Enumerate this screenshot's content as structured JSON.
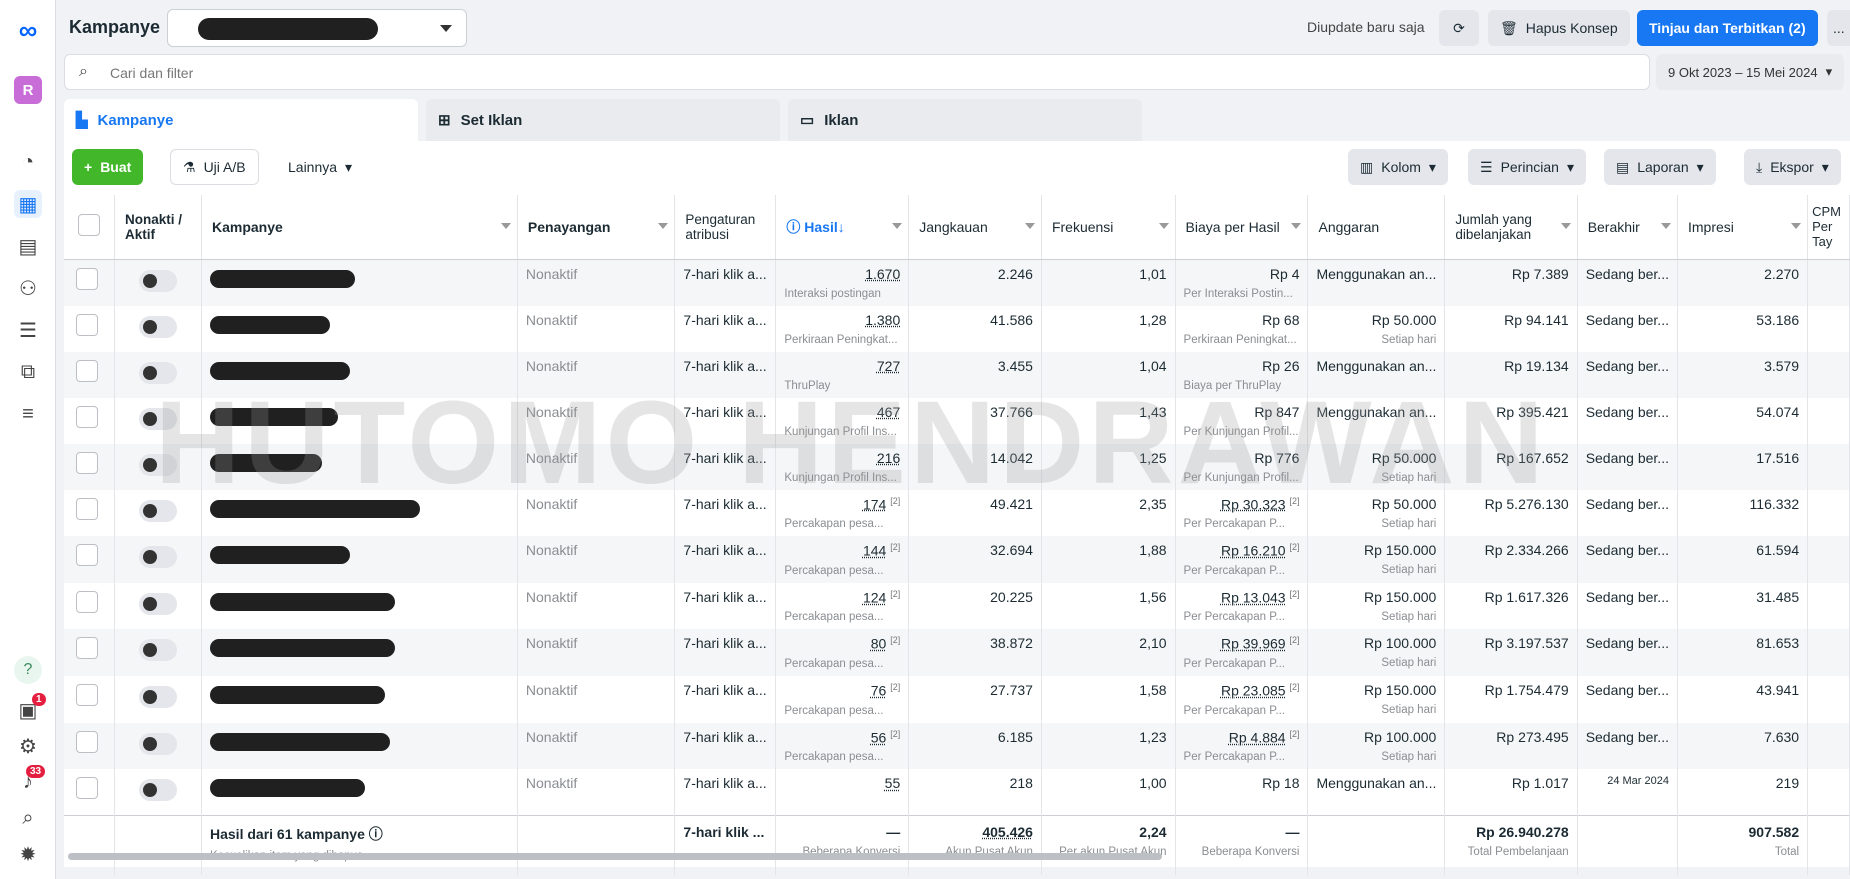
{
  "header": {
    "title": "Kampanye",
    "updated": "Diupdate baru saja",
    "discard": "Hapus Konsep",
    "publish": "Tinjau dan Terbitkan (2)",
    "more": "..."
  },
  "search": {
    "placeholder": "Cari dan filter",
    "date_range": "9 Okt 2023 – 15 Mei 2024"
  },
  "tabs": [
    "Kampanye",
    "Set Iklan",
    "Iklan"
  ],
  "toolbar": {
    "create": "Buat",
    "ab": "Uji A/B",
    "more": "Lainnya",
    "columns": "Kolom",
    "breakdown": "Perincian",
    "reports": "Laporan",
    "export": "Ekspor"
  },
  "rail": {
    "avatar": "R",
    "badge1": "1",
    "badge2": "33",
    "help": "?"
  },
  "columns": [
    "Nonakti / Aktif",
    "Kampanye",
    "Penayangan",
    "Pengaturan atribusi",
    "Hasil",
    "Jangkauan",
    "Frekuensi",
    "Biaya per Hasil",
    "Anggaran",
    "Jumlah yang dibelanjakan",
    "Berakhir",
    "Impresi",
    "CPM Per Tay"
  ],
  "rows": [
    {
      "del": "Nonaktif",
      "attr": "7-hari klik a...",
      "res": "1.670",
      "resSub": "Interaksi postingan",
      "reach": "2.246",
      "freq": "1,01",
      "cpr": "Rp 4",
      "cprSub": "Per Interaksi Postin...",
      "budget": "Menggunakan an...",
      "budgetSub": "",
      "spent": "Rp 7.389",
      "end": "Sedang ber...",
      "imp": "2.270"
    },
    {
      "del": "Nonaktif",
      "attr": "7-hari klik a...",
      "res": "1.380",
      "resSub": "Perkiraan Peningkat...",
      "reach": "41.586",
      "freq": "1,28",
      "cpr": "Rp 68",
      "cprSub": "Perkiraan Peningkat...",
      "budget": "Rp 50.000",
      "budgetSub": "Setiap hari",
      "spent": "Rp 94.141",
      "end": "Sedang ber...",
      "imp": "53.186"
    },
    {
      "del": "Nonaktif",
      "attr": "7-hari klik a...",
      "res": "727",
      "resSub": "ThruPlay",
      "reach": "3.455",
      "freq": "1,04",
      "cpr": "Rp 26",
      "cprSub": "Biaya per ThruPlay",
      "budget": "Menggunakan an...",
      "budgetSub": "",
      "spent": "Rp 19.134",
      "end": "Sedang ber...",
      "imp": "3.579"
    },
    {
      "del": "Nonaktif",
      "attr": "7-hari klik a...",
      "res": "467",
      "resSub": "Kunjungan Profil Ins...",
      "reach": "37.766",
      "freq": "1,43",
      "cpr": "Rp 847",
      "cprSub": "Per Kunjungan Profil...",
      "budget": "Menggunakan an...",
      "budgetSub": "",
      "spent": "Rp 395.421",
      "end": "Sedang ber...",
      "imp": "54.074"
    },
    {
      "del": "Nonaktif",
      "attr": "7-hari klik a...",
      "res": "216",
      "resSub": "Kunjungan Profil Ins...",
      "reach": "14.042",
      "freq": "1,25",
      "cpr": "Rp 776",
      "cprSub": "Per Kunjungan Profil...",
      "budget": "Rp 50.000",
      "budgetSub": "Setiap hari",
      "spent": "Rp 167.652",
      "end": "Sedang ber...",
      "imp": "17.516"
    },
    {
      "del": "Nonaktif",
      "attr": "7-hari klik a...",
      "res": "174",
      "resSub": "Percakapan pesa...",
      "reach": "49.421",
      "freq": "2,35",
      "cpr": "Rp 30.323",
      "cprSub": "Per Percakapan P...",
      "budget": "Rp 50.000",
      "budgetSub": "Setiap hari",
      "spent": "Rp 5.276.130",
      "end": "Sedang ber...",
      "imp": "116.332"
    },
    {
      "del": "Nonaktif",
      "attr": "7-hari klik a...",
      "res": "144",
      "resSub": "Percakapan pesa...",
      "reach": "32.694",
      "freq": "1,88",
      "cpr": "Rp 16.210",
      "cprSub": "Per Percakapan P...",
      "budget": "Rp 150.000",
      "budgetSub": "Setiap hari",
      "spent": "Rp 2.334.266",
      "end": "Sedang ber...",
      "imp": "61.594"
    },
    {
      "del": "Nonaktif",
      "attr": "7-hari klik a...",
      "res": "124",
      "resSub": "Percakapan pesa...",
      "reach": "20.225",
      "freq": "1,56",
      "cpr": "Rp 13.043",
      "cprSub": "Per Percakapan P...",
      "budget": "Rp 150.000",
      "budgetSub": "Setiap hari",
      "spent": "Rp 1.617.326",
      "end": "Sedang ber...",
      "imp": "31.485"
    },
    {
      "del": "Nonaktif",
      "attr": "7-hari klik a...",
      "res": "80",
      "resSub": "Percakapan pesa...",
      "reach": "38.872",
      "freq": "2,10",
      "cpr": "Rp 39.969",
      "cprSub": "Per Percakapan P...",
      "budget": "Rp 100.000",
      "budgetSub": "Setiap hari",
      "spent": "Rp 3.197.537",
      "end": "Sedang ber...",
      "imp": "81.653"
    },
    {
      "del": "Nonaktif",
      "attr": "7-hari klik a...",
      "res": "76",
      "resSub": "Percakapan pesa...",
      "reach": "27.737",
      "freq": "1,58",
      "cpr": "Rp 23.085",
      "cprSub": "Per Percakapan P...",
      "budget": "Rp 150.000",
      "budgetSub": "Setiap hari",
      "spent": "Rp 1.754.479",
      "end": "Sedang ber...",
      "imp": "43.941"
    },
    {
      "del": "Nonaktif",
      "attr": "7-hari klik a...",
      "res": "56",
      "resSub": "Percakapan pesa...",
      "reach": "6.185",
      "freq": "1,23",
      "cpr": "Rp 4.884",
      "cprSub": "Per Percakapan P...",
      "budget": "Rp 100.000",
      "budgetSub": "Setiap hari",
      "spent": "Rp 273.495",
      "end": "Sedang ber...",
      "imp": "7.630"
    },
    {
      "del": "Nonaktif",
      "attr": "7-hari klik a...",
      "res": "55",
      "resSub": "",
      "reach": "218",
      "freq": "1,00",
      "cpr": "Rp 18",
      "cprSub": "",
      "budget": "Menggunakan an...",
      "budgetSub": "",
      "spent": "Rp 1.017",
      "end": "24 Mar 2024",
      "imp": "219"
    }
  ],
  "totals": {
    "label": "Hasil dari 61 kampanye",
    "sub": "Kecualikan item yang dihapus",
    "attr": "7-hari klik ...",
    "res": "—",
    "resSub": "Beberapa Konversi",
    "reach": "405.426",
    "reachSub": "Akun Pusat Akun",
    "freq": "2,24",
    "freqSub": "Per akun Pusat Akun",
    "cpr": "—",
    "cprSub": "Beberapa Konversi",
    "spent": "Rp 26.940.278",
    "spentSub": "Total Pembelanjaan",
    "imp": "907.582",
    "impSub": "Total"
  },
  "watermark": "HUTOMO HENDRAWAN",
  "colors": {
    "accent": "#1877f2",
    "create": "#42b72a"
  }
}
